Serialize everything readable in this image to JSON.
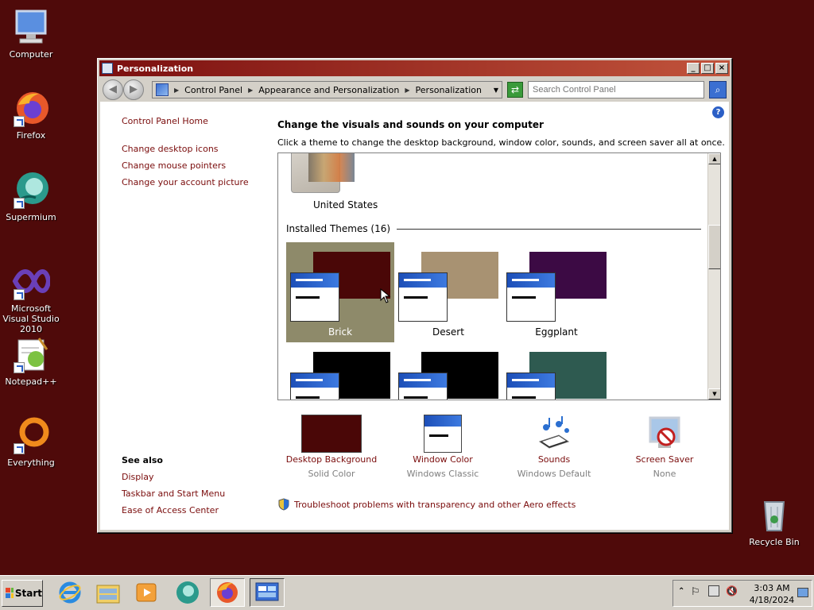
{
  "desktop": {
    "icons": [
      {
        "label": "Computer"
      },
      {
        "label": "Firefox"
      },
      {
        "label": "Supermium"
      },
      {
        "label": "Microsoft Visual Studio 2010"
      },
      {
        "label": "Notepad++"
      },
      {
        "label": "Everything"
      },
      {
        "label": "Recycle Bin"
      }
    ]
  },
  "window": {
    "title": "Personalization",
    "breadcrumb": [
      "Control Panel",
      "Appearance and Personalization",
      "Personalization"
    ],
    "search_placeholder": "Search Control Panel"
  },
  "left_pane": {
    "home": "Control Panel Home",
    "links": [
      "Change desktop icons",
      "Change mouse pointers",
      "Change your account picture"
    ],
    "see_also_title": "See also",
    "see_also": [
      "Display",
      "Taskbar and Start Menu",
      "Ease of Access Center"
    ]
  },
  "main": {
    "heading": "Change the visuals and sounds on your computer",
    "subheading": "Click a theme to change the desktop background, window color, sounds, and screen saver all at once.",
    "partial_theme_label": "United States",
    "installed_header": "Installed Themes (16)",
    "themes": [
      {
        "name": "Brick",
        "color": "#4a0707",
        "selected": true
      },
      {
        "name": "Desert",
        "color": "#a89272",
        "selected": false
      },
      {
        "name": "Eggplant",
        "color": "#3c0a44",
        "selected": false
      },
      {
        "name": "",
        "color": "#000000",
        "selected": false
      },
      {
        "name": "",
        "color": "#000000",
        "selected": false
      },
      {
        "name": "",
        "color": "#2e5a50",
        "selected": false
      }
    ],
    "bottom": [
      {
        "title": "Desktop Background",
        "subtitle": "Solid Color"
      },
      {
        "title": "Window Color",
        "subtitle": "Windows Classic"
      },
      {
        "title": "Sounds",
        "subtitle": "Windows Default"
      },
      {
        "title": "Screen Saver",
        "subtitle": "None"
      }
    ],
    "troubleshoot": "Troubleshoot problems with transparency and other Aero effects"
  },
  "taskbar": {
    "start_label": "Start",
    "time": "3:03 AM",
    "date": "4/18/2024"
  }
}
